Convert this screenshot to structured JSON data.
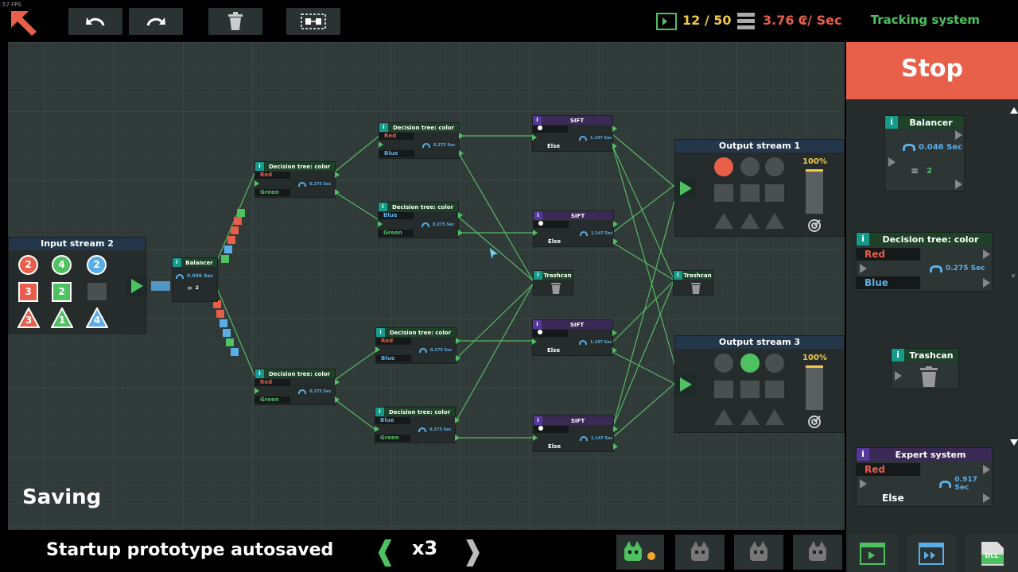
{
  "fps": "57 FPS",
  "resources": {
    "count": "12 / 50",
    "rate": "3.76 ₢/ Sec"
  },
  "tracking_label": "Tracking system",
  "status_text": "Saving",
  "autosave_text": "Startup prototype autosaved",
  "speed": "x3",
  "stop_label": "Stop",
  "colors": {
    "red": "#e85e4b",
    "green": "#4ec261",
    "blue": "#5aaee8",
    "yellow": "#f2c94c",
    "stop": "#e8604a"
  },
  "input_stream": {
    "title": "Input stream 2",
    "shapes": [
      {
        "shape": "circle",
        "color": "red",
        "count": "2"
      },
      {
        "shape": "circle",
        "color": "green",
        "count": "4"
      },
      {
        "shape": "circle",
        "color": "blue",
        "count": "2"
      },
      {
        "shape": "square",
        "color": "red",
        "count": "3"
      },
      {
        "shape": "square",
        "color": "green",
        "count": "2"
      },
      {
        "shape": "square",
        "color": "grey",
        "count": ""
      },
      {
        "shape": "triangle",
        "color": "red",
        "count": "3"
      },
      {
        "shape": "triangle",
        "color": "green",
        "count": "1"
      },
      {
        "shape": "triangle",
        "color": "blue",
        "count": "4"
      }
    ]
  },
  "nodes": {
    "balancer": {
      "title": "Balancer",
      "time": "0.046 Sec",
      "count": "2"
    },
    "dt1": {
      "title": "Decision tree: color",
      "out1": "Red",
      "out2": "Green",
      "time": "0.275 Sec"
    },
    "dt2": {
      "title": "Decision tree: color",
      "out1": "Red",
      "out2": "Green",
      "time": "0.275 Sec"
    },
    "dt3": {
      "title": "Decision tree: color",
      "out1": "Red",
      "out2": "Blue",
      "time": "0.275 Sec"
    },
    "dt4": {
      "title": "Decision tree: color",
      "out1": "Blue",
      "out2": "Green",
      "time": "0.275 Sec"
    },
    "dt5": {
      "title": "Decision tree: color",
      "out1": "Red",
      "out2": "Blue",
      "time": "0.275 Sec"
    },
    "dt6": {
      "title": "Decision tree: color",
      "out1": "Blue",
      "out2": "Green",
      "time": "0.275 Sec"
    },
    "sift1": {
      "title": "SIFT",
      "out2": "Else",
      "time": "1.147 Sec"
    },
    "sift2": {
      "title": "SIFT",
      "out2": "Else",
      "time": "1.147 Sec"
    },
    "sift3": {
      "title": "SIFT",
      "out2": "Else",
      "time": "1.147 Sec"
    },
    "sift4": {
      "title": "SIFT",
      "out2": "Else",
      "time": "1.147 Sec"
    },
    "trash1": {
      "title": "Trashcan"
    },
    "trash2": {
      "title": "Trashcan"
    }
  },
  "output_streams": [
    {
      "title": "Output stream 1",
      "percent": "100%",
      "progress": 1.0,
      "active_shape": "red-circle"
    },
    {
      "title": "Output stream 3",
      "percent": "100%",
      "progress": 1.0,
      "active_shape": "green-circle"
    }
  ],
  "panel": {
    "balancer": {
      "title": "Balancer",
      "time": "0.046 Sec",
      "count": "2"
    },
    "decision_tree": {
      "title": "Decision tree: color",
      "out1": "Red",
      "out2": "Blue",
      "time": "0.275 Sec"
    },
    "trashcan": {
      "title": "Trashcan"
    },
    "expert": {
      "title": "Expert system",
      "out1": "Red",
      "out2": "Else",
      "time": "0.917 Sec"
    }
  },
  "bottom_icons": [
    "robot-icon-active",
    "robot-icon",
    "robot-icon",
    "robot-icon"
  ],
  "bottom_buttons": [
    "import-icon",
    "export-icon",
    "dll-icon"
  ],
  "dll_label": "DLL"
}
